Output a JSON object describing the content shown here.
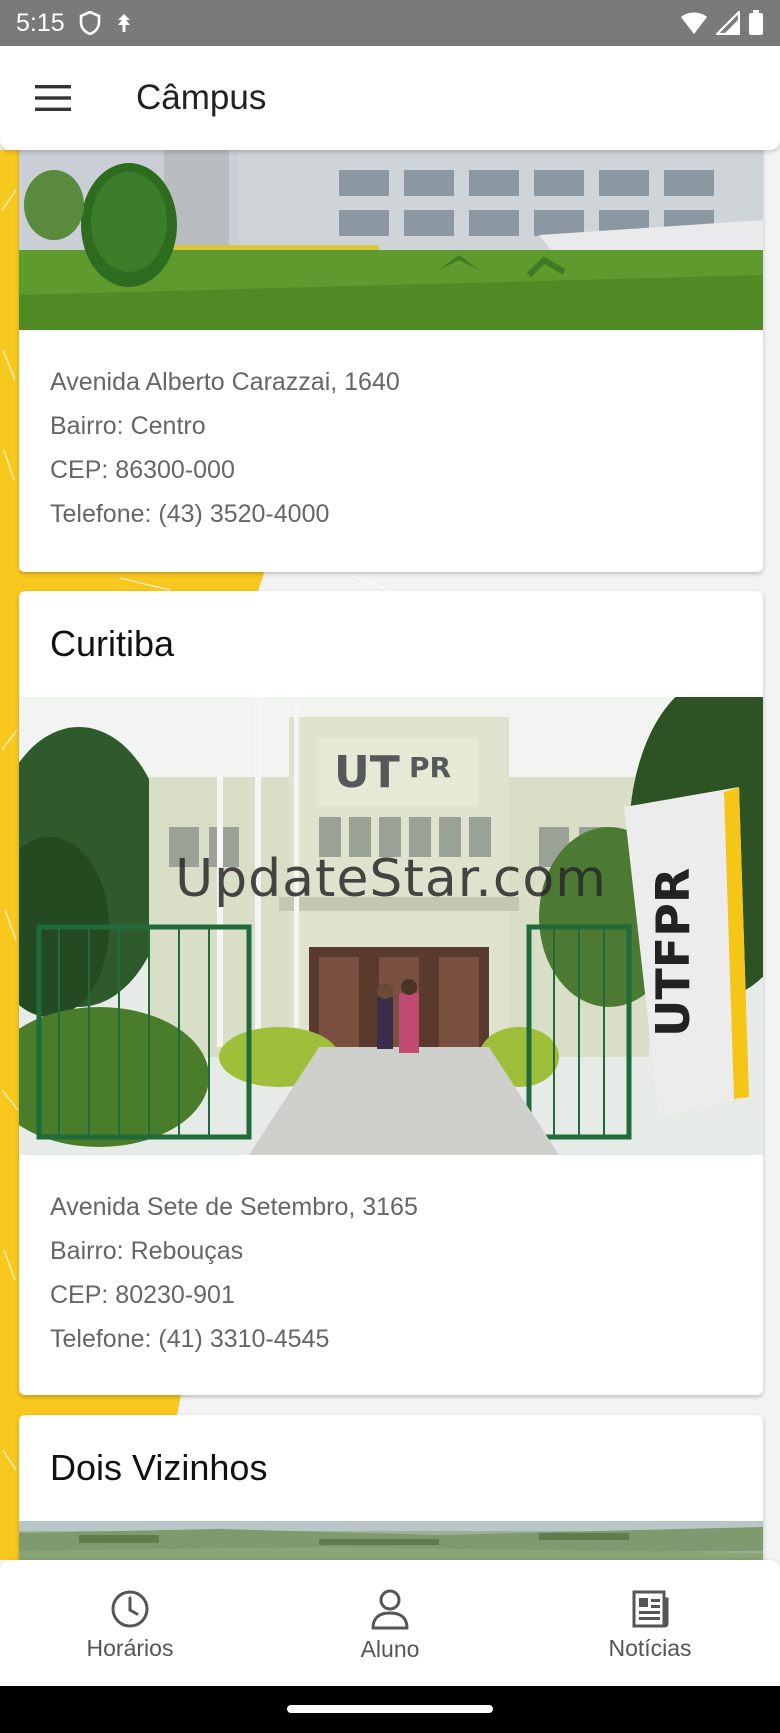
{
  "status_bar": {
    "time": "5:15",
    "icons": [
      "shield-icon",
      "data-saver-icon",
      "wifi-icon",
      "signal-icon",
      "battery-icon"
    ]
  },
  "app_bar": {
    "menu_icon": "menu-icon",
    "title": "Câmpus"
  },
  "campuses": [
    {
      "name": "",
      "address": "Avenida Alberto Carazzai, 1640",
      "neighborhood": "Bairro: Centro",
      "cep": "CEP: 86300-000",
      "phone": "Telefone: (43) 3520-4000"
    },
    {
      "name": "Curitiba",
      "watermark": "UpdateStar.com",
      "address": "Avenida Sete de Setembro, 3165",
      "neighborhood": "Bairro: Rebouças",
      "cep": "CEP: 80230-901",
      "phone": "Telefone: (41) 3310-4545"
    },
    {
      "name": "Dois Vizinhos"
    }
  ],
  "bottom_nav": [
    {
      "label": "Horários",
      "icon": "clock-icon"
    },
    {
      "label": "Aluno",
      "icon": "person-icon"
    },
    {
      "label": "Notícias",
      "icon": "newspaper-icon"
    }
  ],
  "colors": {
    "accent_yellow": "#f9c81e",
    "status_bar": "#7a7a7a",
    "text_secondary": "#666666"
  }
}
